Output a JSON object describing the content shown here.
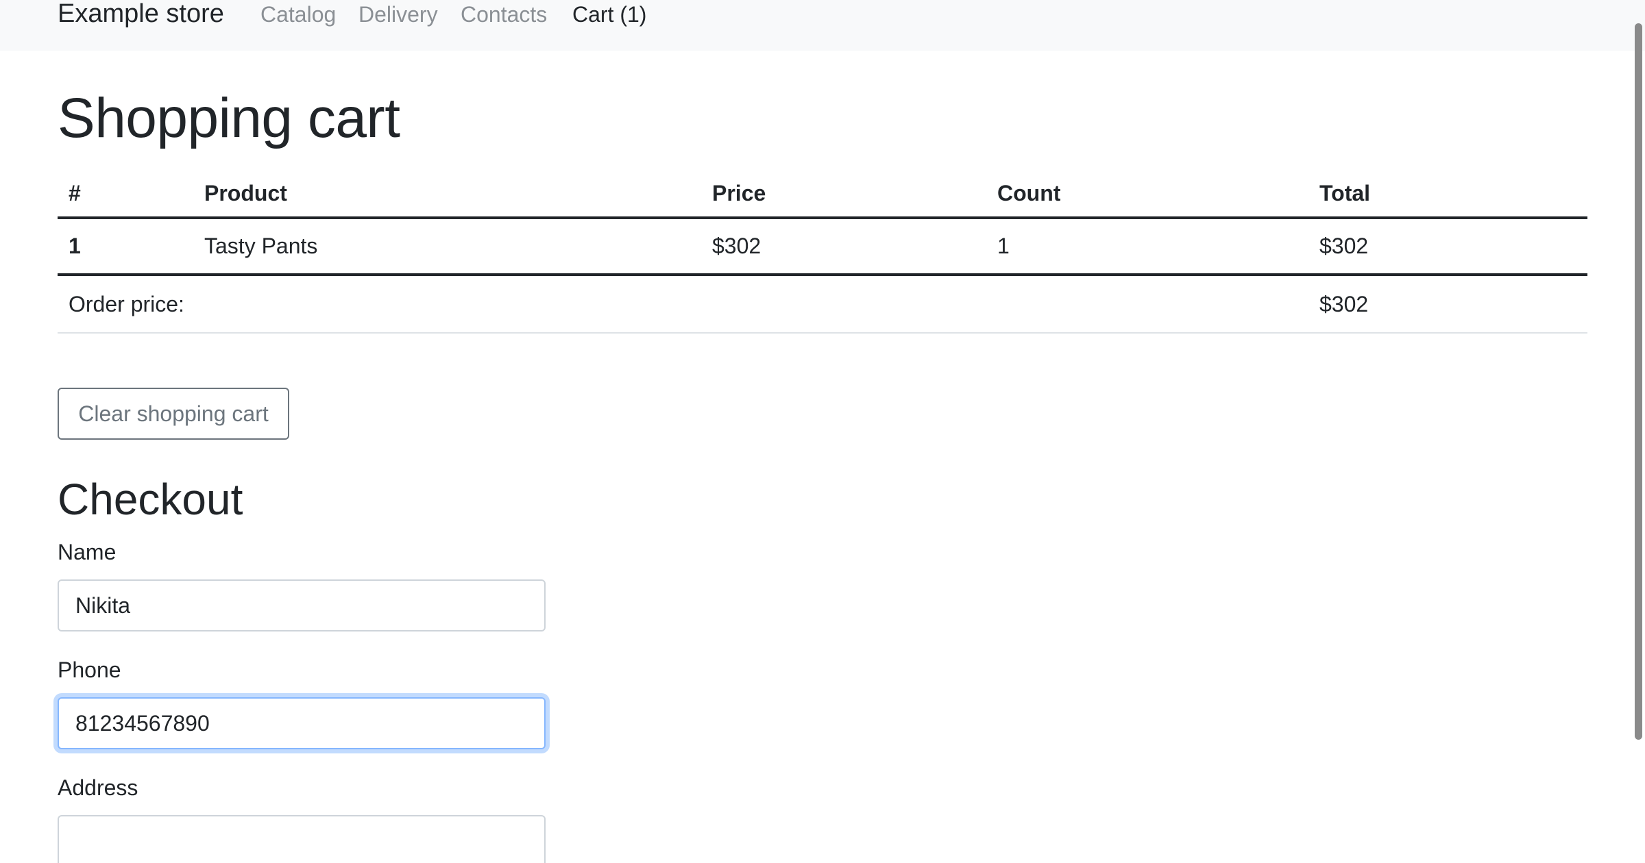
{
  "navbar": {
    "brand": "Example store",
    "links": [
      "Catalog",
      "Delivery",
      "Contacts",
      "Cart (1)"
    ]
  },
  "cart": {
    "title": "Shopping cart",
    "headers": [
      "#",
      "Product",
      "Price",
      "Count",
      "Total"
    ],
    "rows": [
      [
        "1",
        "Tasty Pants",
        "$302",
        "1",
        "$302"
      ]
    ],
    "order_price_label": "Order price:",
    "order_price_value": "$302",
    "clear_button": "Clear shopping cart"
  },
  "checkout": {
    "title": "Checkout",
    "name_label": "Name",
    "name_value": "Nikita",
    "phone_label": "Phone",
    "phone_value": "81234567890",
    "address_label": "Address",
    "address_value": ""
  },
  "colors": {
    "navbar_bg": "#f8f9fa",
    "focus_border": "#86b7fe",
    "secondary": "#6c757d"
  }
}
